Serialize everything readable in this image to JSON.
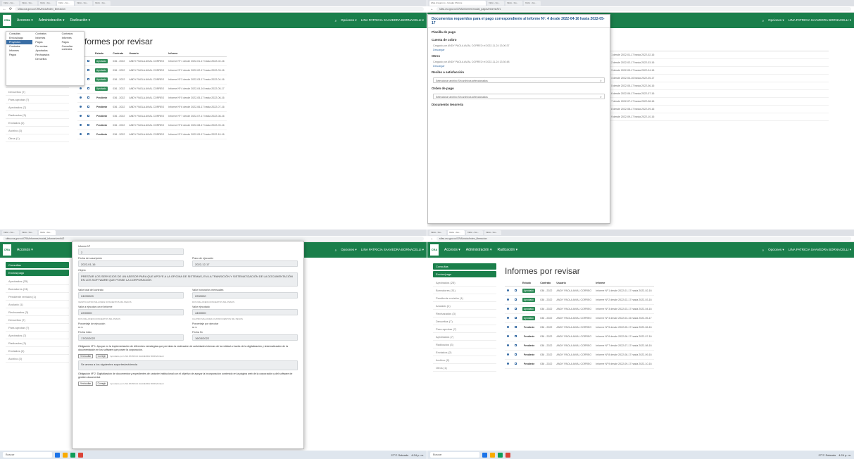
{
  "browser": {
    "tabs": [
      "Inicio - Go...",
      "Inicio - Go...",
      "Inicio - Go...",
      "Inicio - Go...",
      "Inicio - Go...",
      "Inicio - Go...",
      "Inicio - Go...",
      "Inicio - Go..."
    ],
    "url_q1": "sifas.cra.gov.co/CRA/inicio/index_liberacion",
    "url_q2": "sifas.cra.gov.co/CRA/informes/modal_pagos/informe/5/1",
    "url_q3": "sifas.cra.gov.co/CRA/informes/modal_informe/ver/id/2",
    "url_q4": "sifas.cra.gov.co/CRA/inicio/index_liberacion",
    "window_title_q2": "sifas.cra.gov.co - Google Chrome"
  },
  "nav": {
    "logo": "CRA",
    "menu_items": [
      "Accesos ▾",
      "Administración ▾",
      "Radicación ▾"
    ],
    "right_items": [
      "Opciones ▾",
      "LINA PATRICIA SAAVEDRA BORNACELLI ▾"
    ]
  },
  "sidebar": {
    "buttons": [
      "Consultas",
      "Envíos/pago"
    ],
    "items": [
      "Aprobados (25)",
      "Borradores (31)",
      "Pendiente revisión (1)",
      "Anulado (1)",
      "Rechazados (3)",
      "Devueltos (7)",
      "Para aprobar (7)",
      "Aprobados (7)",
      "Radicados (3)",
      "Enviados (2)",
      "Archivo (2)",
      "Otros (1)"
    ]
  },
  "dropdown": {
    "col1": [
      "Consultas",
      "Envíos/pago",
      "Proyectos",
      "Contratos",
      "Informes",
      "Pagos"
    ],
    "col2": [
      "Contratos",
      "Informes",
      "Pagos",
      "Por revisar",
      "Aprobados",
      "Rechazados",
      "Devueltos"
    ],
    "col3": [
      "Contratos",
      "Informes",
      "Pagos",
      "Consultar contratos"
    ]
  },
  "main": {
    "title": "Informes por revisar",
    "columns": [
      "",
      "",
      "Estado",
      "Contrato",
      "Usuario",
      "Informe"
    ],
    "rows": [
      {
        "estado": "Aprobado",
        "contrato": "036 - 2022",
        "usuario": "ANDY PAOLA AVIAL CORREO",
        "informe": "Informe Nº 1 desde 2022-01-17 hasta 2022-02-16"
      },
      {
        "estado": "Aprobado",
        "contrato": "036 - 2022",
        "usuario": "ANDY PAOLA AVIAL CORREO",
        "informe": "Informe Nº 2 desde 2022-02-17 hasta 2022-03-16"
      },
      {
        "estado": "Aprobado",
        "contrato": "036 - 2022",
        "usuario": "ANDY PAOLA AVIAL CORREO",
        "informe": "Informe Nº 3 desde 2022-03-17 hasta 2022-04-16"
      },
      {
        "estado": "Aprobado",
        "contrato": "036 - 2022",
        "usuario": "ANDY PAOLA AVIAL CORREO",
        "informe": "Informe Nº 4 desde 2022-04-16 hasta 2022-05-17"
      },
      {
        "estado": "Pendiente",
        "contrato": "036 - 2022",
        "usuario": "ANDY PAOLA AVIAL CORREO",
        "informe": "Informe Nº 5 desde 2022-05-17 hasta 2022-06-16"
      },
      {
        "estado": "Pendiente",
        "contrato": "036 - 2022",
        "usuario": "ANDY PAOLA AVIAL CORREO",
        "informe": "Informe Nº 6 desde 2022-06-17 hasta 2022-07-16"
      },
      {
        "estado": "Pendiente",
        "contrato": "036 - 2022",
        "usuario": "ANDY PAOLA AVIAL CORREO",
        "informe": "Informe Nº 7 desde 2022-07-17 hasta 2022-08-16"
      },
      {
        "estado": "Pendiente",
        "contrato": "036 - 2022",
        "usuario": "ANDY PAOLA AVIAL CORREO",
        "informe": "Informe Nº 8 desde 2022-08-17 hasta 2022-09-16"
      },
      {
        "estado": "Pendiente",
        "contrato": "036 - 2022",
        "usuario": "ANDY PAOLA AVIAL CORREO",
        "informe": "Informe Nº 9 desde 2022-09-17 hasta 2022-10-16"
      }
    ]
  },
  "pay_modal": {
    "header": "Documentos requeridos para el pago correspondiente al informe Nº: 4 desde 2022-04-16 hasta 2022-05-17",
    "sections": [
      {
        "title": "Planilla de pago",
        "sub": "",
        "action": ""
      },
      {
        "title": "Cuenta de cobro",
        "sub": "Cargado por ANDY PAOLA AVIAL CORREO el 2022-11-24 13:00:37",
        "action": "Descargar"
      },
      {
        "title": "Otros",
        "sub": "Cargado por ANDY PAOLA AVIAL CORREO el 2022-11-24 13:30:48",
        "action": "Descargar"
      },
      {
        "title": "Recibo a satisfacción",
        "sub": "",
        "action": ""
      },
      {
        "title": "Orden de pago",
        "sub": "",
        "action": ""
      },
      {
        "title": "Documento tesorería",
        "sub": "",
        "action": ""
      }
    ],
    "file_placeholder": "Seleccionar archivo   Sin archivos seleccionados"
  },
  "report_form": {
    "fields": [
      {
        "label": "Informe Nº",
        "value": "2"
      },
      {
        "label": "Fecha de suscripción",
        "value": "2022-01-16"
      },
      {
        "label": "Plazo de ejecución",
        "value": "2022-12-17"
      },
      {
        "label": "Objeto",
        "value": "PRESTAR LOS SERVICIOS DE UN ASESOR PARA QUE APOYE A LA OFICINA DE SISTEMAS, EN LA TRANSICIÓN Y SISTEMATIZACIÓN DE LA DOCUMENTACIÓN EN LOS SOFTWARE QUE POSEE LA CORPORACIÓN"
      },
      {
        "label": "Valor total del contrato",
        "value": "24200000"
      },
      {
        "label": "Valor honorarios mensuales",
        "value": "2200000"
      },
      {
        "label": "Valor a ejecutar con el informe",
        "value": "2200000"
      },
      {
        "label": "Valor ejecutado",
        "value": "4400000"
      },
      {
        "label": "Porcentaje de ejecución",
        "value": "18 %"
      },
      {
        "label": "Porcentaje por ejecutar",
        "value": "82 %"
      },
      {
        "label": "Fecha inicio",
        "value": "17/02/2022"
      },
      {
        "label": "Fecha fin",
        "value": "16/03/2022"
      }
    ],
    "words": [
      "VEINTICUATRO MILLONES DOSCIENTOS MIL PESOS",
      "DOS MILLONES DOSCIENTOS MIL PESOS",
      "DOS MILLONES DOSCIENTOS MIL PESOS",
      "CUATRO MILLONES CUATROCIENTOS MIL PESOS"
    ],
    "obligation1": "Obligación Nº 1: Apoyar en la implementación de diferentes estrategias que permitan la realización de actividades internas de la entidad a través de la digitalización y sistematización de la documentación en los software que posee la corporación.",
    "obligation1_note": "Se anexa a los siguientes soportes/evidencia",
    "obligation2": "Obligación Nº 2: Digitalización de documentos y expedientes de carácter institucional con el objetivo de apoyar la incorporación contenido en la página web de la corporación y del software de gestión documental.",
    "buttons": [
      "Ver/ocultar",
      "Corregir",
      "Aprobado"
    ],
    "approved_by": "Aprobado por LINA PATRICIA SAAVEDRA BORNACELLI"
  },
  "taskbar": {
    "search": "Buscar",
    "weather": "27°C Soleado",
    "time": "4:24 p. m."
  },
  "colors": {
    "brand": "#1a7f4b",
    "approved": "#2e8b57",
    "link": "#3a6ea5"
  }
}
